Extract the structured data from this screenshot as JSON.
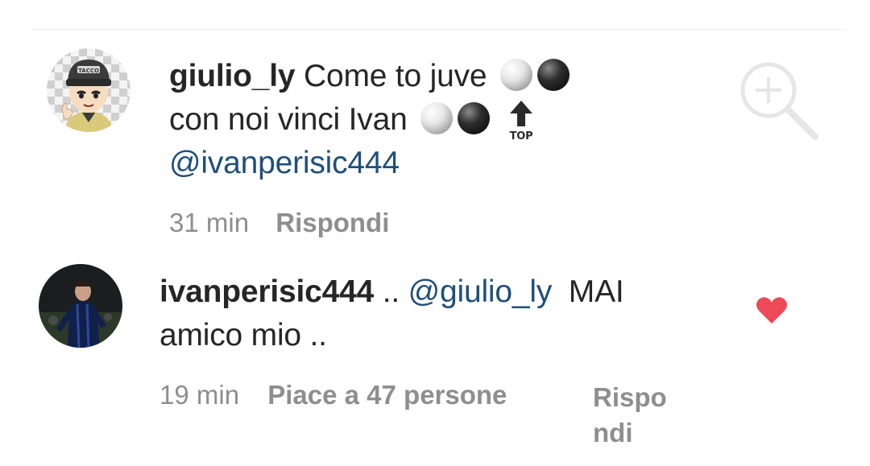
{
  "comments": [
    {
      "username": "giulio_ly",
      "text_line1": "Come to juve",
      "text_line2": "con noi vinci Ivan",
      "mention": "@ivanperisic444",
      "avatar_icon": "cartoon-avatar-icon",
      "emoji_line1": [
        "white-ball-icon",
        "black-ball-icon"
      ],
      "emoji_line2": [
        "white-ball-icon",
        "black-ball-icon",
        "top-arrow-icon"
      ],
      "top_label": "TOP",
      "cap_label": "TACCO",
      "time": "31 min",
      "reply_label": "Rispondi"
    },
    {
      "username": "ivanperisic444",
      "separator": "..",
      "mention": "@giulio_ly",
      "text_line1": "MAI",
      "text_line2": "amico mio ..",
      "avatar_icon": "player-photo-avatar-icon",
      "time": "19 min",
      "likes_label": "Piace a 47 persone",
      "reply_line1": "Rispo",
      "reply_line2": "ndi",
      "liked": true
    }
  ],
  "colors": {
    "username": "#262626",
    "mention": "#1f4f7a",
    "meta": "#8e8e8e",
    "heart": "#ed4956"
  }
}
